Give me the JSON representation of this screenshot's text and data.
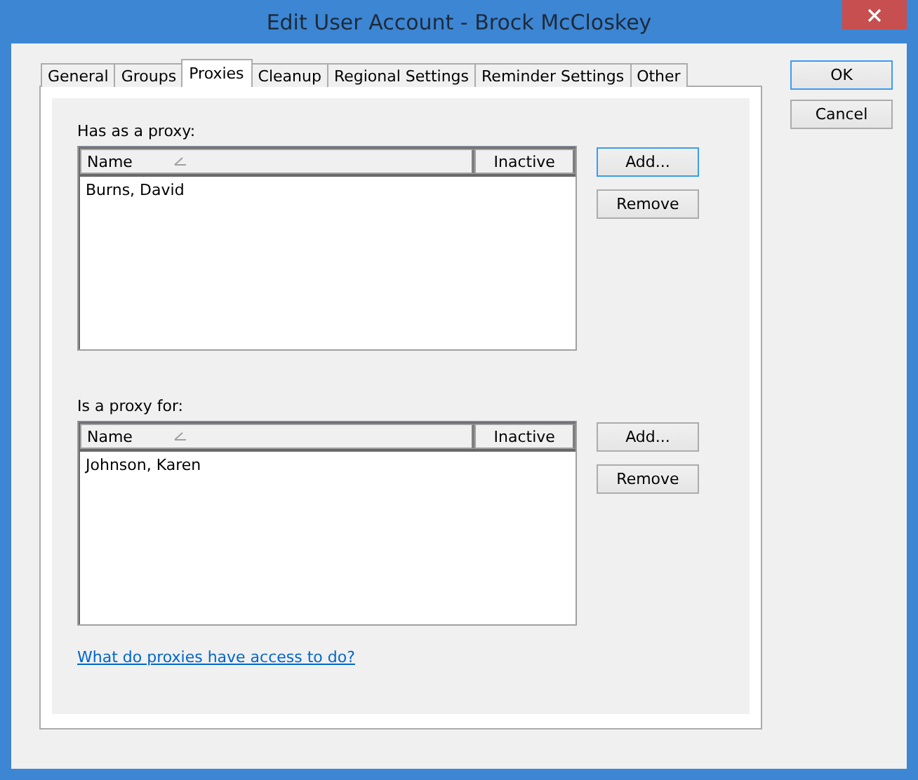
{
  "window": {
    "title": "Edit User Account - Brock McCloskey"
  },
  "tabs": [
    {
      "label": "General",
      "selected": false
    },
    {
      "label": "Groups",
      "selected": false
    },
    {
      "label": "Proxies",
      "selected": true
    },
    {
      "label": "Cleanup",
      "selected": false
    },
    {
      "label": "Regional Settings",
      "selected": false
    },
    {
      "label": "Reminder Settings",
      "selected": false
    },
    {
      "label": "Other",
      "selected": false
    }
  ],
  "sections": [
    {
      "label": "Has as a proxy:",
      "columns": [
        "Name",
        "Inactive"
      ],
      "rows": [
        {
          "name": "Burns, David"
        }
      ],
      "buttons": [
        {
          "label": "Add...",
          "focused": true
        },
        {
          "label": "Remove",
          "focused": false
        }
      ]
    },
    {
      "label": "Is a proxy for:",
      "columns": [
        "Name",
        "Inactive"
      ],
      "rows": [
        {
          "name": "Johnson, Karen"
        }
      ],
      "buttons": [
        {
          "label": "Add...",
          "focused": false
        },
        {
          "label": "Remove",
          "focused": false
        }
      ]
    }
  ],
  "link": "What do proxies have access to do?",
  "dialog_buttons": [
    {
      "label": "OK",
      "focused": true
    },
    {
      "label": "Cancel",
      "focused": false
    }
  ]
}
